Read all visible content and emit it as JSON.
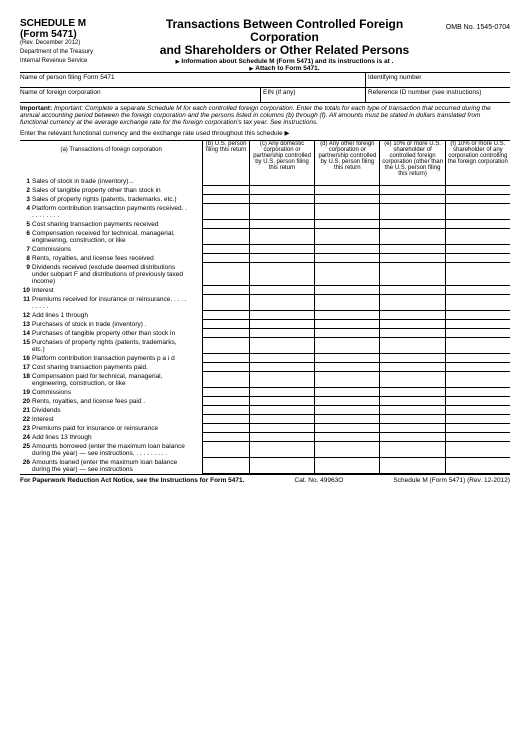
{
  "header": {
    "schedule": "SCHEDULE M",
    "form": "(Form 5471)",
    "rev": "(Rev. December 2012)",
    "dept1": "Department of the Treasury",
    "dept2": "Internal Revenue Service",
    "title1": "Transactions Between Controlled Foreign Corporation",
    "title2": "and Shareholders or Other Related Persons",
    "sub1": "Information about Schedule M (Form 5471) and its instructions is at .",
    "sub2": "Attach to Form 5471.",
    "omb": "OMB No. 1545-0704"
  },
  "name_row": {
    "left": "Name of person filing Form 5471",
    "right": "Identifying number"
  },
  "corp_row": {
    "a": "Name of foreign corporation",
    "b": "EIN (if any)",
    "c": "Reference ID number (see instructions)"
  },
  "important": "Important: Complete a separate Schedule M for each controlled foreign corporation. Enter the totals for each type of transaction that occurred during the annual accounting period between the foreign corporation and the persons listed in columns (b) through (f). All amounts must be stated in dollars translated from functional currency at the average exchange rate for the foreign corporation's tax year. See instructions.",
  "currency_line": "Enter the relevant functional currency and the exchange rate used throughout this schedule ▶",
  "cols": {
    "a": "(a) Transactions of foreign corporation",
    "b": "(b) U.S. person filing this return",
    "c": "(c) Any domestic corporation or partnership controlled by U.S. person filing this return",
    "d": "(d) Any other foreign corporation or partnership controlled by U.S. person filing this return",
    "e": "(e) 10% or more U.S. shareholder of controlled foreign corporation (other than the U.S. person filing this return)",
    "f": "(f) 10% or more U.S. shareholder of any corporation controlling the foreign corporation"
  },
  "lines": [
    {
      "n": "1",
      "t": "Sales of stock in trade (inventory)..."
    },
    {
      "n": "2",
      "t": "Sales of tangible property other than stock in"
    },
    {
      "n": "3",
      "t": "Sales of property rights (patents, trademarks, etc.)"
    },
    {
      "n": "4",
      "t": "Platform contribution transaction payments received. . . . . . . . . ."
    },
    {
      "n": "5",
      "t": "Cost sharing transaction payments received"
    },
    {
      "n": "6",
      "t": "Compensation received for technical, managerial, engineering, construction, or like"
    },
    {
      "n": "7",
      "t": "Commissions"
    },
    {
      "n": "8",
      "t": "Rents, royalties, and license fees received"
    },
    {
      "n": "9",
      "t": "Dividends received (exclude deemed distributions under subpart F and distributions of previously taxed income)"
    },
    {
      "n": "10",
      "t": "Interest"
    },
    {
      "n": "11",
      "t": "Premiums received for insurance or reinsurance. . . . . . . . . ."
    },
    {
      "n": "12",
      "t": "Add lines 1 through"
    },
    {
      "n": "13",
      "t": "Purchases of stock in trade (inventory) ."
    },
    {
      "n": "14",
      "t": "Purchases of tangible property other than stock in"
    },
    {
      "n": "15",
      "t": "Purchases of property rights (patents, trademarks, etc.)"
    },
    {
      "n": "16",
      "t": "Platform contribution transaction payments p a i d"
    },
    {
      "n": "17",
      "t": "Cost sharing transaction payments paid."
    },
    {
      "n": "18",
      "t": "Compensation paid for technical, managerial, engineering, construction, or like"
    },
    {
      "n": "19",
      "t": "Commissions"
    },
    {
      "n": "20",
      "t": "Rents, royalties, and license fees paid ."
    },
    {
      "n": "21",
      "t": "Dividends"
    },
    {
      "n": "22",
      "t": "Interest"
    },
    {
      "n": "23",
      "t": "Premiums paid for insurance or reinsurance"
    },
    {
      "n": "24",
      "t": "Add lines 13 through"
    },
    {
      "n": "25",
      "t": "Amounts borrowed (enter the maximum loan balance during the year) — see instructions. . . . . . . . . ."
    },
    {
      "n": "26",
      "t": "Amounts loaned (enter the maximum loan balance during the year) — see instructions"
    }
  ],
  "footer": {
    "left": "For Paperwork Reduction Act Notice, see the Instructions for Form 5471.",
    "mid": "Cat. No. 49963O",
    "right": "Schedule M (Form 5471) (Rev. 12-2012)"
  }
}
